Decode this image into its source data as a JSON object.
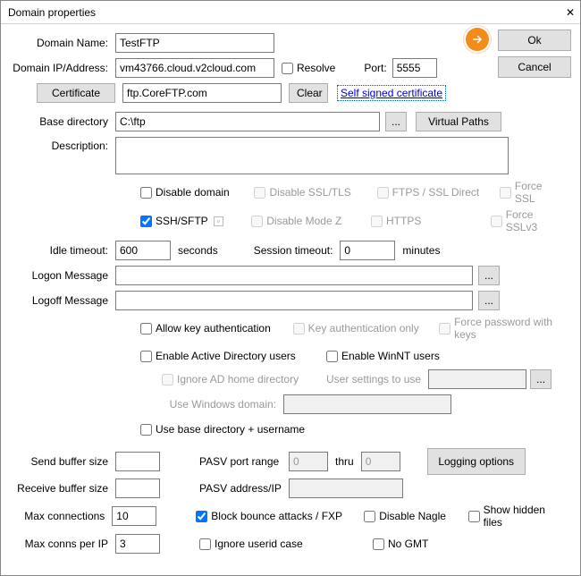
{
  "title": "Domain properties",
  "buttons": {
    "ok": "Ok",
    "cancel": "Cancel",
    "certificate": "Certificate",
    "clear": "Clear",
    "self_signed": "Self signed certificate",
    "virtual_paths": "Virtual Paths",
    "logging_options": "Logging options",
    "browse": "...",
    "ellipsis": "..."
  },
  "labels": {
    "domain_name": "Domain Name:",
    "domain_ip": "Domain IP/Address:",
    "resolve": "Resolve",
    "port": "Port:",
    "base_directory": "Base directory",
    "description": "Description:",
    "idle_timeout": "Idle timeout:",
    "seconds": "seconds",
    "session_timeout": "Session timeout:",
    "minutes": "minutes",
    "logon_message": "Logon Message",
    "logoff_message": "Logoff Message",
    "send_buffer": "Send buffer size",
    "receive_buffer": "Receive buffer size",
    "max_connections": "Max connections",
    "max_conns_ip": "Max conns per IP",
    "pasv_range": "PASV port range",
    "thru": "thru",
    "pasv_addr": "PASV address/IP",
    "use_windows_domain": "Use Windows domain:",
    "user_settings": "User settings to use",
    "ignore_ad": "Ignore AD home directory"
  },
  "checks": {
    "disable_domain": "Disable domain",
    "disable_ssl": "Disable SSL/TLS",
    "ftps_ssl_direct": "FTPS / SSL Direct",
    "force_ssl": "Force SSL",
    "ssh_sftp": "SSH/SFTP",
    "disable_modez": "Disable Mode Z",
    "https": "HTTPS",
    "force_sslv3": "Force SSLv3",
    "allow_key_auth": "Allow key authentication",
    "key_auth_only": "Key authentication only",
    "force_pw_keys": "Force password with keys",
    "enable_ad": "Enable Active Directory users",
    "enable_winnt": "Enable WinNT users",
    "use_base_dir_user": "Use base directory + username",
    "block_bounce": "Block bounce attacks / FXP",
    "ignore_userid": "Ignore userid case",
    "disable_nagle": "Disable Nagle",
    "no_gmt": "No GMT",
    "show_hidden": "Show hidden files"
  },
  "values": {
    "domain_name": "TestFTP",
    "domain_ip": "vm43766.cloud.v2cloud.com",
    "port": "5555",
    "certificate": "ftp.CoreFTP.com",
    "base_directory": "C:\\ftp",
    "description": "",
    "idle_timeout": "600",
    "session_timeout": "0",
    "logon_message": "",
    "logoff_message": "",
    "send_buffer": "",
    "receive_buffer": "",
    "max_connections": "10",
    "max_conns_ip": "3",
    "pasv_from": "0",
    "pasv_to": "0",
    "pasv_addr": "",
    "windows_domain": "",
    "user_settings": ""
  }
}
